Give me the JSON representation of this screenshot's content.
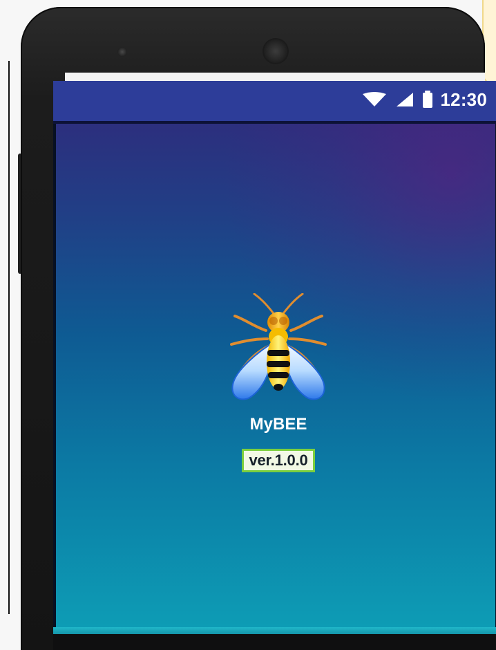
{
  "status_bar": {
    "time": "12:30",
    "icons": [
      "wifi-icon",
      "signal-icon",
      "battery-icon"
    ]
  },
  "app": {
    "title": "MyBEE",
    "version": "ver.1.0.0",
    "logo": "bee-logo-icon"
  },
  "colors": {
    "status_bar": "#2d3d99",
    "background_top": "#2c2f7e",
    "background_bottom": "#0d9cb5",
    "version_border": "#7bcf3e",
    "version_fill": "#f2f9e5",
    "title": "#ffffff"
  }
}
